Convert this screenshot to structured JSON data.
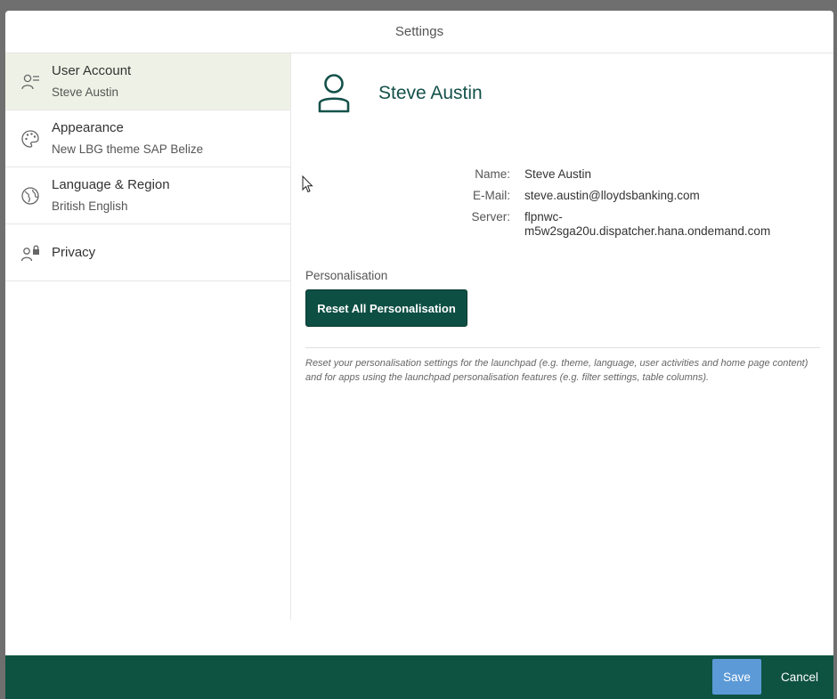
{
  "dialog": {
    "title": "Settings"
  },
  "sidebar": {
    "items": [
      {
        "title": "User Account",
        "subtitle": "Steve Austin",
        "icon": "user-list-icon",
        "selected": true
      },
      {
        "title": "Appearance",
        "subtitle": "New LBG theme SAP Belize",
        "icon": "palette-icon",
        "selected": false
      },
      {
        "title": "Language & Region",
        "subtitle": "British English",
        "icon": "globe-icon",
        "selected": false
      },
      {
        "title": "Privacy",
        "subtitle": "",
        "icon": "user-lock-icon",
        "selected": false
      }
    ]
  },
  "account": {
    "display_name": "Steve Austin",
    "icon": "person-icon",
    "fields": [
      {
        "label": "Name:",
        "value": "Steve Austin"
      },
      {
        "label": "E-Mail:",
        "value": "steve.austin@lloydsbanking.com"
      },
      {
        "label": "Server:",
        "value": "flpnwc-m5w2sga20u.dispatcher.hana.ondemand.com"
      }
    ],
    "personalisation_label": "Personalisation",
    "reset_button_label": "Reset All Personalisation",
    "reset_description": "Reset your personalisation settings for the launchpad (e.g. theme, language, user activities and home page content) and for apps using the launchpad personalisation features (e.g. filter settings, table columns)."
  },
  "footer": {
    "save_label": "Save",
    "cancel_label": "Cancel"
  },
  "colors": {
    "accent": "#0e5242",
    "save": "#5b9ad6",
    "selected_bg": "#eef2e6",
    "name_text": "#14514a"
  }
}
